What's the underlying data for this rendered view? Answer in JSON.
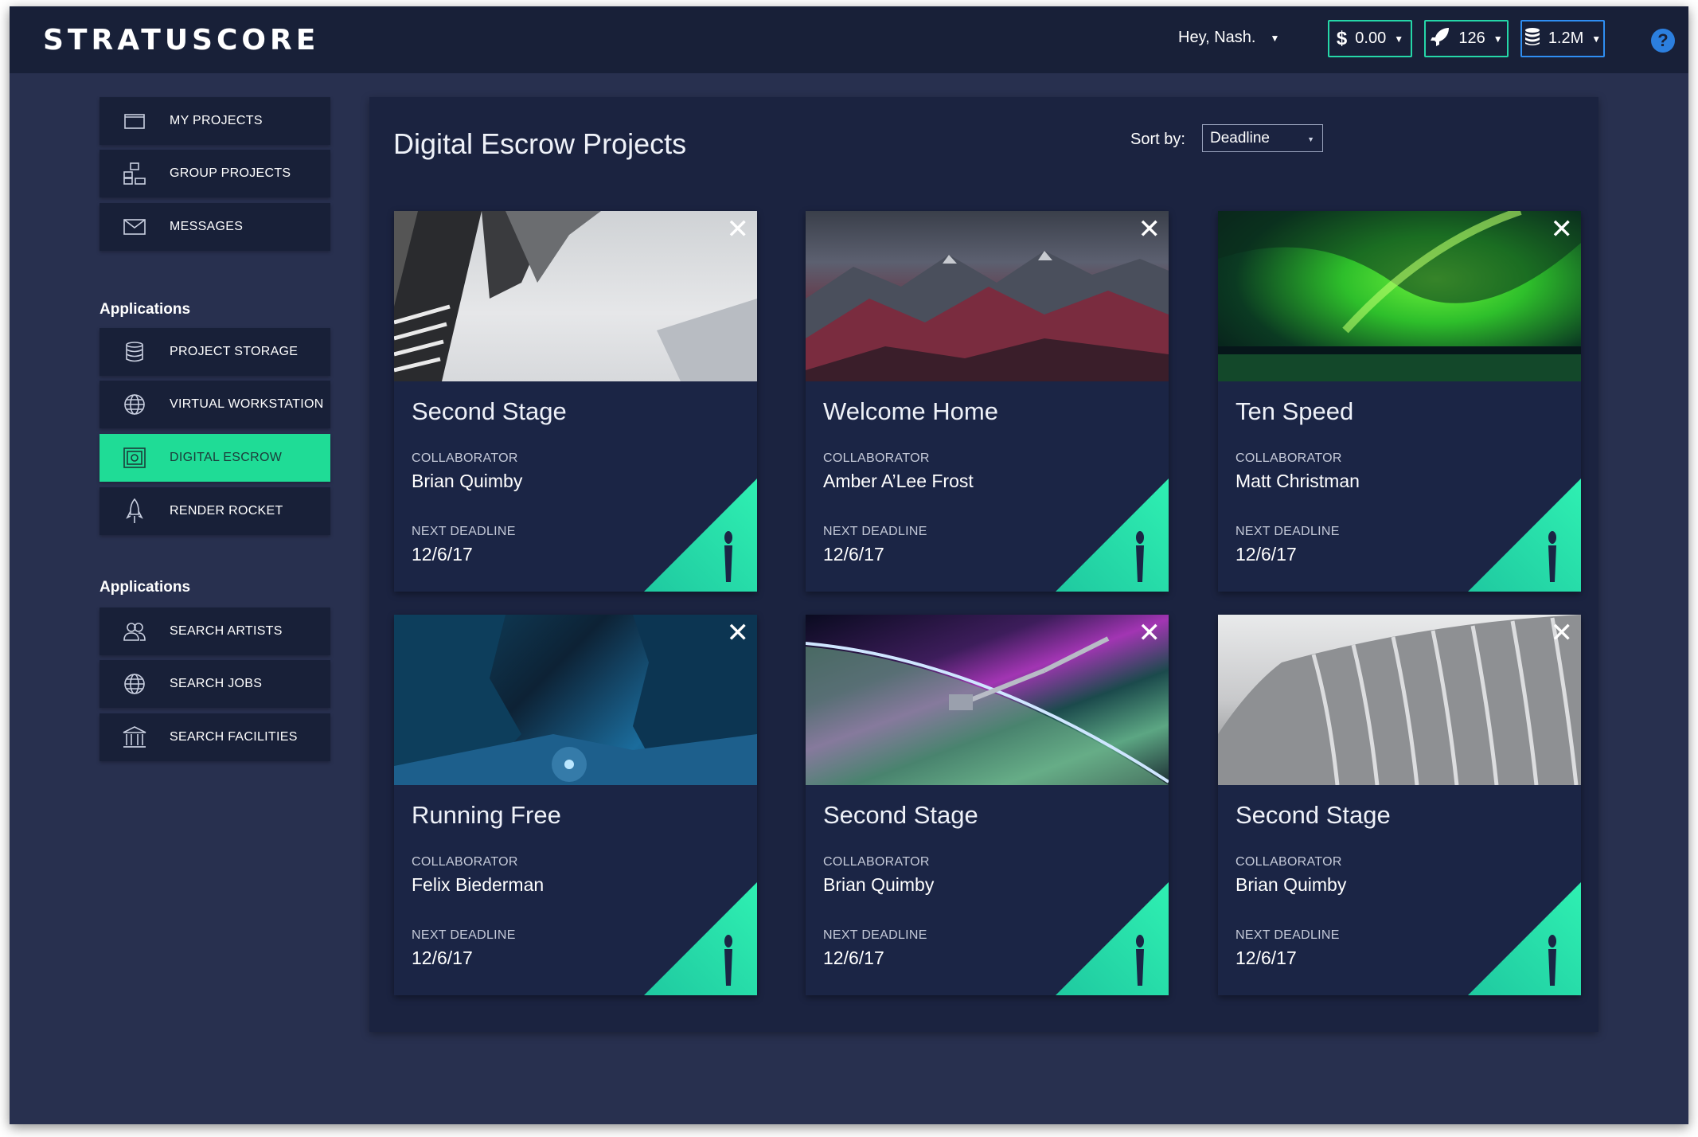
{
  "app": {
    "logo_text": "STRATUSCORE",
    "greeting": "Hey, Nash.",
    "balance": "0.00",
    "rockets": "126",
    "storage": "1.2M",
    "help_symbol": "?"
  },
  "sidebar": {
    "group1": [
      {
        "label": "MY PROJECTS",
        "icon": "folder-icon"
      },
      {
        "label": "GROUP PROJECTS",
        "icon": "group-projects-icon"
      },
      {
        "label": "MESSAGES",
        "icon": "envelope-icon"
      }
    ],
    "heading2": "Applications",
    "group2": [
      {
        "label": "PROJECT STORAGE",
        "icon": "database-icon"
      },
      {
        "label": "VIRTUAL WORKSTATION",
        "icon": "globe-icon"
      },
      {
        "label": "DIGITAL ESCROW",
        "icon": "safe-icon",
        "active": true
      },
      {
        "label": "RENDER ROCKET",
        "icon": "rocket-icon"
      }
    ],
    "heading3": "Applications",
    "group3": [
      {
        "label": "SEARCH ARTISTS",
        "icon": "people-icon"
      },
      {
        "label": "SEARCH JOBS",
        "icon": "globe-icon"
      },
      {
        "label": "SEARCH FACILITIES",
        "icon": "building-icon"
      }
    ]
  },
  "main": {
    "title": "Digital Escrow Projects",
    "sort_label": "Sort by:",
    "sort_value": "Deadline",
    "collaborator_label": "COLLABORATOR",
    "deadline_label": "NEXT DEADLINE",
    "cards": [
      {
        "title": "Second Stage",
        "collaborator": "Brian Quimby",
        "deadline": "12/6/17"
      },
      {
        "title": "Welcome Home",
        "collaborator": "Amber A’Lee Frost",
        "deadline": "12/6/17"
      },
      {
        "title": "Ten Speed",
        "collaborator": "Matt Christman",
        "deadline": "12/6/17"
      },
      {
        "title": "Running Free",
        "collaborator": "Felix Biederman",
        "deadline": "12/6/17"
      },
      {
        "title": "Second Stage",
        "collaborator": "Brian Quimby",
        "deadline": "12/6/17"
      },
      {
        "title": "Second Stage",
        "collaborator": "Brian Quimby",
        "deadline": "12/6/17"
      }
    ]
  },
  "colors": {
    "accent_green": "#1fdc96",
    "accent_teal": "#25d7a8",
    "accent_blue": "#2f8ef2",
    "background": "#28304f",
    "panel": "#1b2340"
  }
}
